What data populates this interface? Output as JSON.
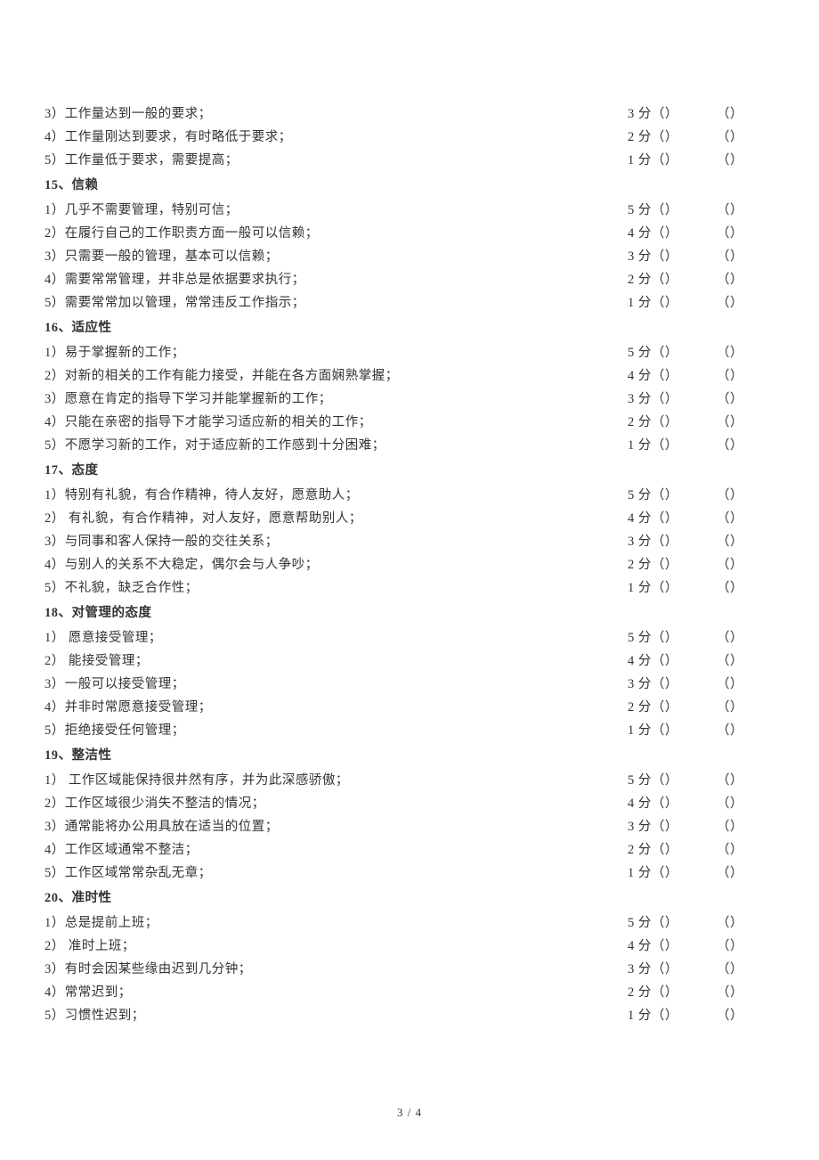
{
  "paren_open": "（",
  "paren_close": "）",
  "footer": {
    "page": "3",
    "sep": " / ",
    "total": "4"
  },
  "sections": [
    {
      "heading": null,
      "items": [
        {
          "text": "3）工作量达到一般的要求；",
          "score": "3 分"
        },
        {
          "text": "4）工作量刚达到要求，有时略低于要求；",
          "score": "2 分"
        },
        {
          "text": "5）工作量低于要求，需要提高；",
          "score": "1 分"
        }
      ]
    },
    {
      "heading": "15、信赖",
      "items": [
        {
          "text": "1）几乎不需要管理，特别可信；",
          "score": "5 分"
        },
        {
          "text": "2）在履行自己的工作职责方面一般可以信赖；",
          "score": "4 分"
        },
        {
          "text": "3）只需要一般的管理，基本可以信赖；",
          "score": "3 分"
        },
        {
          "text": "4）需要常常管理，并非总是依据要求执行；",
          "score": "2 分"
        },
        {
          "text": "5）需要常常加以管理，常常违反工作指示；",
          "score": "1 分"
        }
      ]
    },
    {
      "heading": "16、适应性",
      "items": [
        {
          "text": "1）易于掌握新的工作；",
          "score": "5 分"
        },
        {
          "text": "2）对新的相关的工作有能力接受，并能在各方面娴熟掌握；",
          "score": "4 分"
        },
        {
          "text": "3）愿意在肯定的指导下学习并能掌握新的工作；",
          "score": "3 分"
        },
        {
          "text": "4）只能在亲密的指导下才能学习适应新的相关的工作；",
          "score": "2 分"
        },
        {
          "text": "5）不愿学习新的工作，对于适应新的工作感到十分困难；",
          "score": "1 分"
        }
      ]
    },
    {
      "heading": "17、态度",
      "items": [
        {
          "text": "1）特别有礼貌，有合作精神，待人友好，愿意助人；",
          "score": "5 分"
        },
        {
          "text": "2）  有礼貌，有合作精神，对人友好，愿意帮助别人；",
          "score": "4 分"
        },
        {
          "text": "3）与同事和客人保持一般的交往关系；",
          "score": "3 分"
        },
        {
          "text": "4）与别人的关系不大稳定，偶尔会与人争吵；",
          "score": "2 分"
        },
        {
          "text": "5）不礼貌，缺乏合作性；",
          "score": "1 分"
        }
      ]
    },
    {
      "heading": "18、对管理的态度",
      "items": [
        {
          "text": "1）  愿意接受管理；",
          "score": "5 分"
        },
        {
          "text": "2）  能接受管理；",
          "score": "4 分"
        },
        {
          "text": "3）一般可以接受管理；",
          "score": "3 分"
        },
        {
          "text": "4）并非时常愿意接受管理；",
          "score": "2 分"
        },
        {
          "text": "5）拒绝接受任何管理；",
          "score": "1 分"
        }
      ]
    },
    {
      "heading": "19、整洁性",
      "items": [
        {
          "text": "1）  工作区域能保持很井然有序，并为此深感骄傲；",
          "score": "5 分"
        },
        {
          "text": "2）工作区域很少消失不整洁的情况；",
          "score": "4 分"
        },
        {
          "text": "3）通常能将办公用具放在适当的位置；",
          "score": "3 分"
        },
        {
          "text": "4）工作区域通常不整洁；",
          "score": "2 分"
        },
        {
          "text": "5）工作区域常常杂乱无章；",
          "score": "1 分"
        }
      ]
    },
    {
      "heading": "20、准时性",
      "items": [
        {
          "text": "1）总是提前上班；",
          "score": "5 分"
        },
        {
          "text": "2）  准时上班；",
          "score": "4 分"
        },
        {
          "text": "3）有时会因某些缘由迟到几分钟；",
          "score": "3 分"
        },
        {
          "text": "4）常常迟到；",
          "score": "2 分"
        },
        {
          "text": "5）习惯性迟到；",
          "score": "1 分"
        }
      ]
    }
  ]
}
